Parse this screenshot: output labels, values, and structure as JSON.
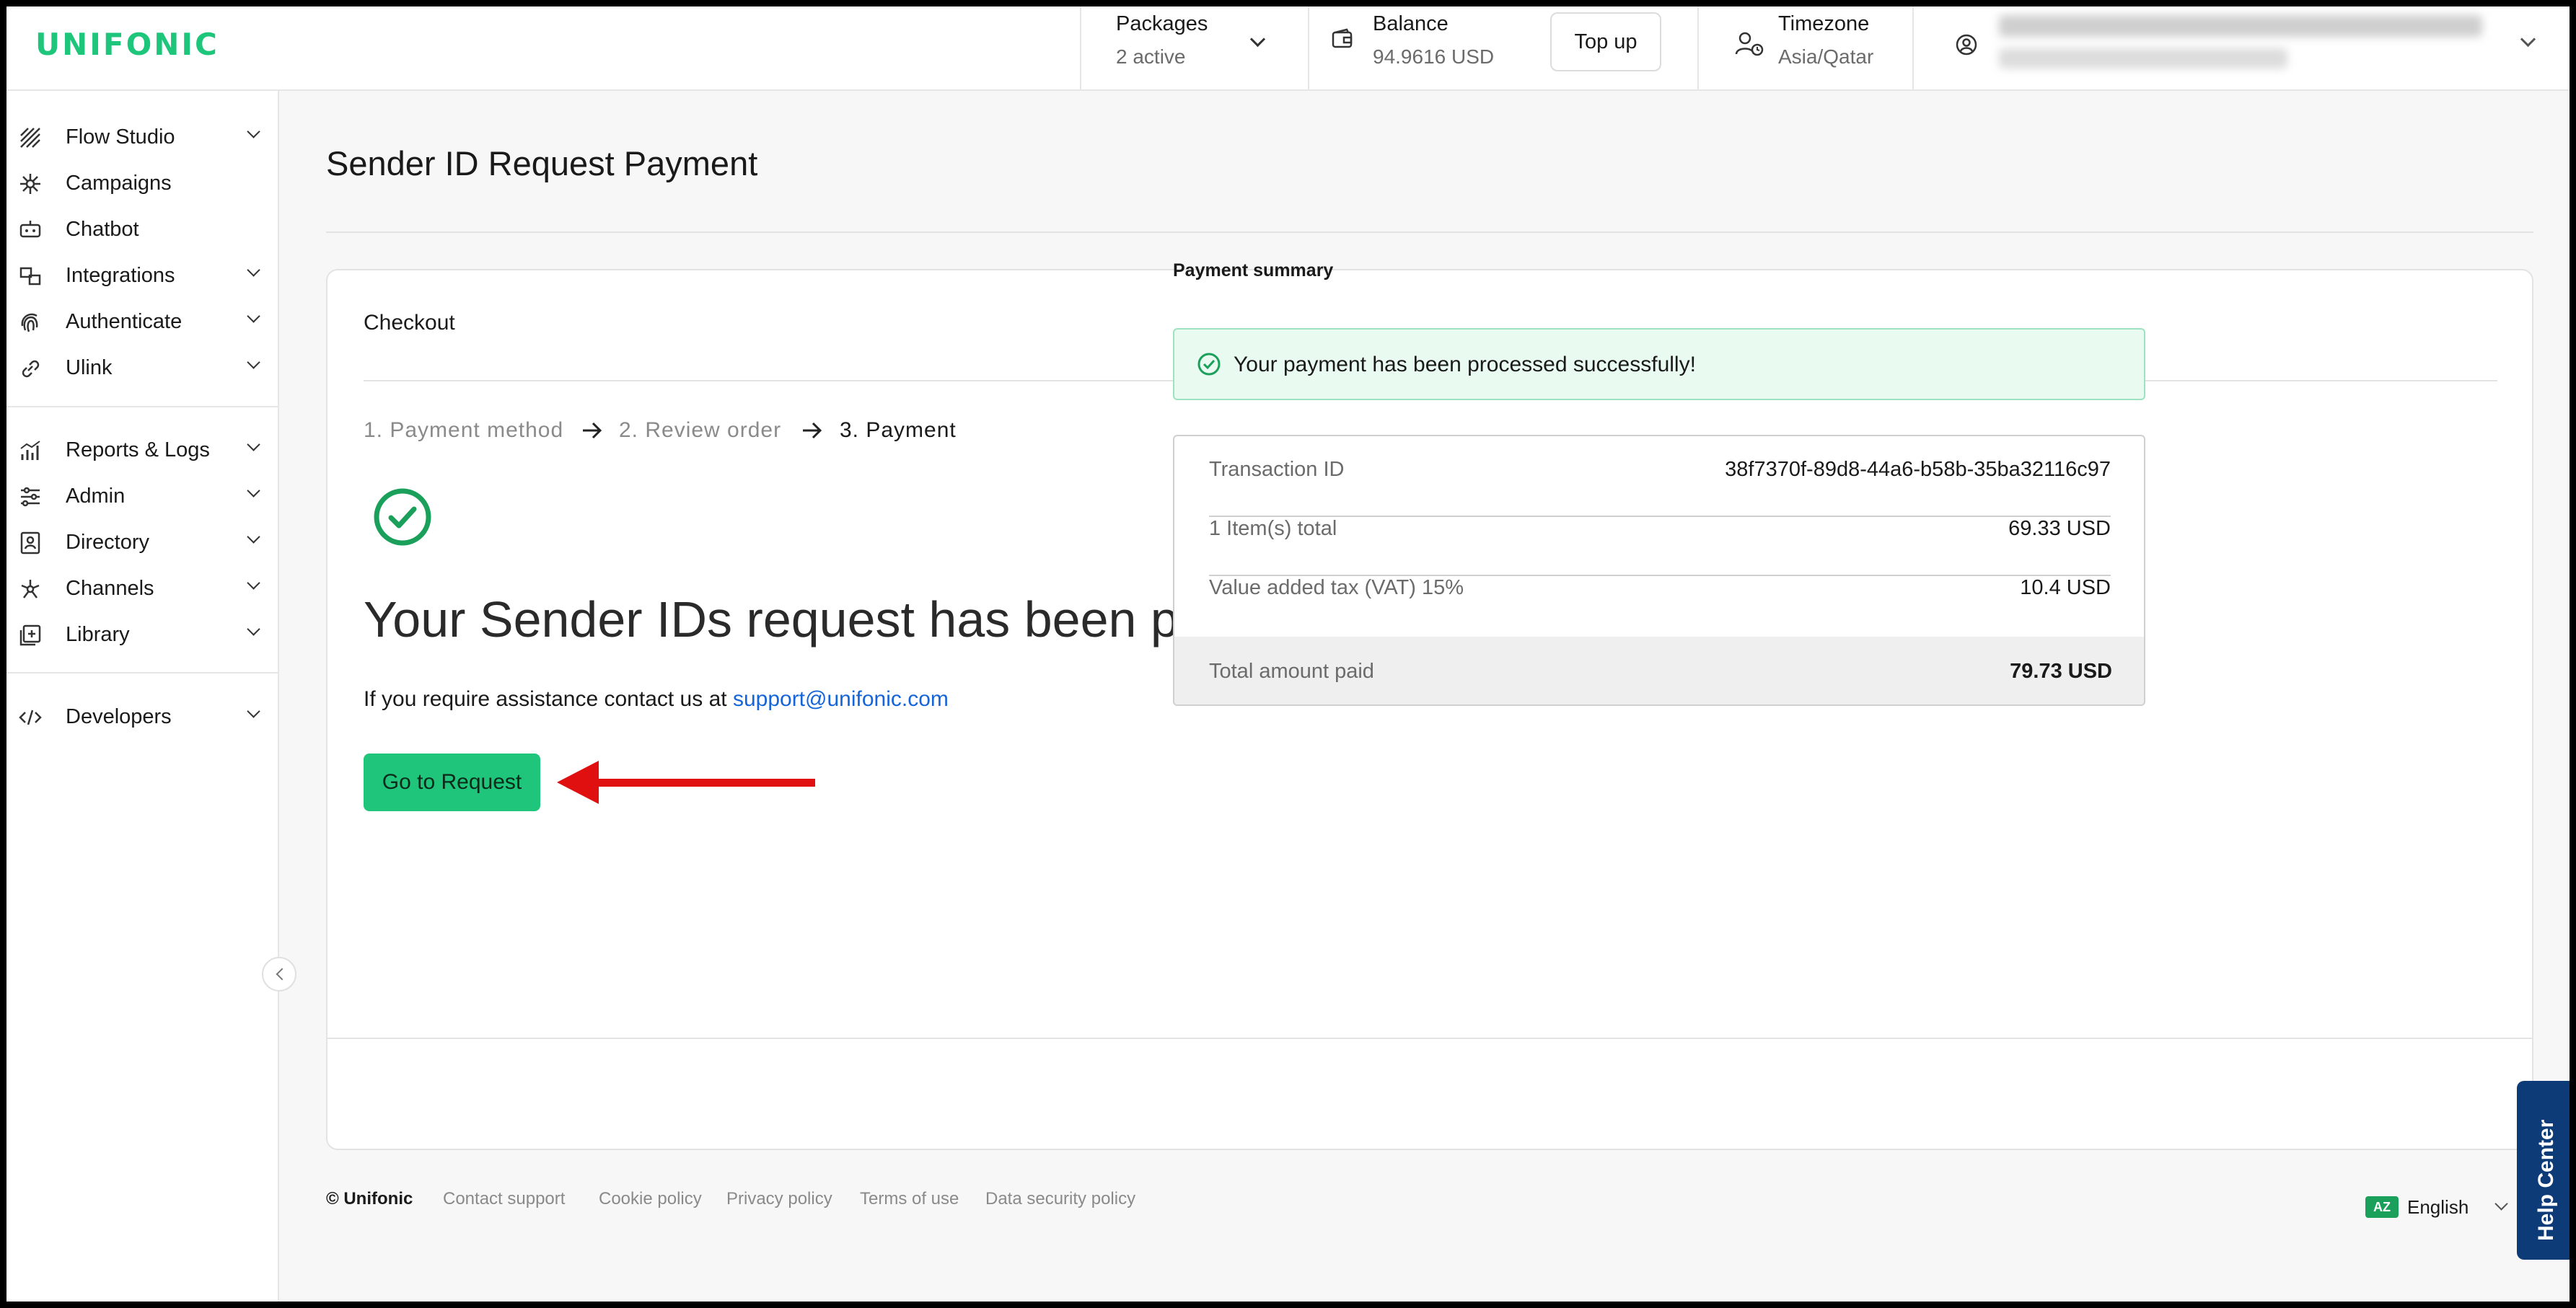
{
  "app": {
    "logo": "UNIFONIC"
  },
  "header": {
    "packages": {
      "label": "Packages",
      "value": "2 active"
    },
    "balance": {
      "label": "Balance",
      "value": "94.9616 USD",
      "top_up_label": "Top up"
    },
    "timezone": {
      "label": "Timezone",
      "value": "Asia/Qatar"
    }
  },
  "sidebar": {
    "items": [
      {
        "label": "Flow Studio",
        "icon": "flow-studio-icon"
      },
      {
        "label": "Campaigns",
        "icon": "campaigns-icon"
      },
      {
        "label": "Chatbot",
        "icon": "chatbot-icon"
      },
      {
        "label": "Integrations",
        "icon": "integrations-icon"
      },
      {
        "label": "Authenticate",
        "icon": "fingerprint-icon"
      },
      {
        "label": "Ulink",
        "icon": "link-icon"
      },
      {
        "label": "Reports & Logs",
        "icon": "reports-icon"
      },
      {
        "label": "Admin",
        "icon": "sliders-icon"
      },
      {
        "label": "Directory",
        "icon": "directory-icon"
      },
      {
        "label": "Channels",
        "icon": "channels-icon"
      },
      {
        "label": "Library",
        "icon": "library-icon"
      },
      {
        "label": "Developers",
        "icon": "code-icon"
      }
    ]
  },
  "page": {
    "title": "Sender ID Request Payment"
  },
  "checkout": {
    "title": "Checkout",
    "steps": [
      "1. Payment method",
      "2. Review order",
      "3. Payment"
    ],
    "current_step": 3,
    "headline": "Your Sender IDs request has been paid",
    "assist_text": "If you require assistance contact us at",
    "support_email": "support@unifonic.com",
    "go_to_request_label": "Go to Request"
  },
  "payment_summary": {
    "title": "Payment summary",
    "success_message": "Your payment has been processed successfully!",
    "rows": [
      {
        "label": "Transaction ID",
        "value": "38f7370f-89d8-44a6-b58b-35ba32116c97"
      },
      {
        "label": "1 Item(s) total",
        "value": "69.33 USD"
      },
      {
        "label": "Value added tax (VAT) 15%",
        "value": "10.4 USD"
      }
    ],
    "total": {
      "label": "Total amount paid",
      "value": "79.73 USD"
    }
  },
  "footer": {
    "copyright": "© Unifonic",
    "links": [
      "Contact support",
      "Cookie policy",
      "Privacy policy",
      "Terms of use",
      "Data security policy"
    ],
    "language": "English"
  },
  "help_center_label": "Help Center",
  "colors": {
    "brand": "#1dc67b",
    "primary_button": "#1ec57b",
    "link": "#1565d8",
    "annotation_arrow": "#e01010",
    "help_center": "#0d3b78"
  }
}
